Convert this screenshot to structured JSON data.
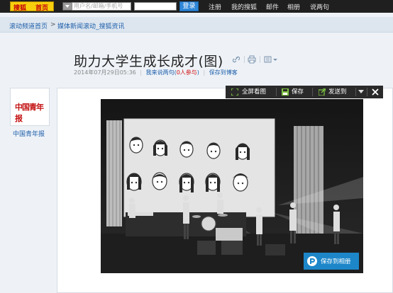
{
  "topbar": {
    "logo_text": "搜狐",
    "logo_home": "首页",
    "account_placeholder": "用户名/邮箱/手机号",
    "login_label": "登录",
    "nav": [
      "注册",
      "我的搜狐",
      "邮件",
      "相册",
      "说两句"
    ]
  },
  "breadcrumb": {
    "home": "滚动频道首页",
    "separator": ">",
    "current": "媒体新闻滚动_搜狐资讯"
  },
  "article": {
    "title": "助力大学生成长成才(图)",
    "date": "2014年07月29日05:36",
    "comment_link": "我来说两句",
    "participants_open": "(",
    "participants_count": "0人参与",
    "participants_close": ")",
    "save_blog": "保存到博客"
  },
  "source": {
    "logo_text": "中国青年报",
    "name": "中国青年报"
  },
  "photo_toolbar": {
    "fullscreen_label": "全屏看图",
    "save_label": "保存",
    "send_label": "发送到"
  },
  "photo": {
    "save_album_label": "保存到相册"
  },
  "colors": {
    "topbar_bg": "#1f1f1f",
    "logo_bg": "#f7cf0d",
    "link_blue": "#1e5faa",
    "toolbar_bg": "#2a2a2a",
    "save_album_bg": "#1d86c9",
    "highlight_red": "#d01010"
  }
}
